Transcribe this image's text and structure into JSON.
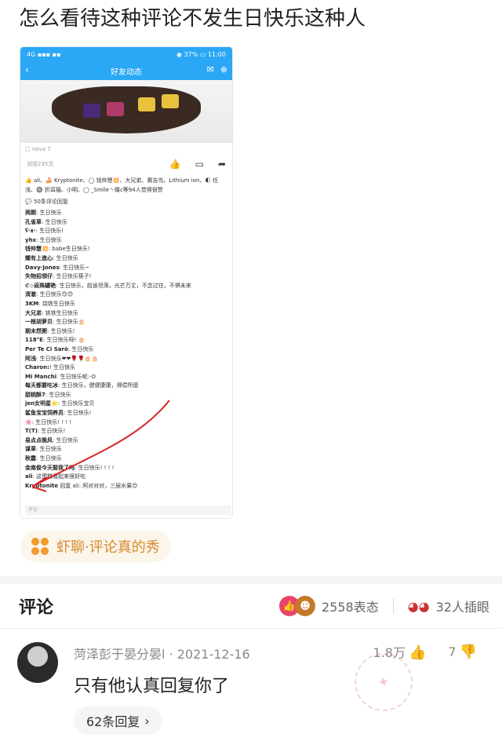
{
  "title": "怎么看待这种评论不发生日快乐这种人",
  "shot": {
    "status_left": "4G ▪▪▪ ▪▪",
    "status_right": "◉ 37% ▭ 11:00",
    "nav_title": "好友动态",
    "device": "▢ nova 7",
    "views": "浏览235次",
    "likes_line": "👍 ali、🍰 Kryptonite、◯ 钱仲慧💥、大兄弟、赛吉鸟、Lithium ion、🌓 任浅、🔘 折耳猫、小明、◯ _Smile丶蝶c等94人觉得很赞",
    "comment_count": "💬 50条评论回复",
    "comments": [
      {
        "name": "两颗",
        "text": ": 生日快乐"
      },
      {
        "name": "孔雀草",
        "text": ": 生日快乐"
      },
      {
        "name": "ʕ·ᴥ·",
        "text": ": 生日快乐!"
      },
      {
        "name": "yhx",
        "text": ": 生日快乐"
      },
      {
        "name": "钱仲慧💥",
        "text": ": babe生日快乐!"
      },
      {
        "name": "耀有上進心",
        "text": ": 生日快乐"
      },
      {
        "name": "Davy·Jones",
        "text": ": 生日快乐~"
      },
      {
        "name": "失物招领仔",
        "text": ": 生日快乐筷子!"
      },
      {
        "name": "ℭ◇返殊罐艳",
        "text": ": 生日快乐，前途坦荡，光芒万丈，不念过往，不惧未来"
      },
      {
        "name": "清澈",
        "text": ": 生日快乐😊😊"
      },
      {
        "name": "3KM",
        "text": ": 烧铁生日快乐"
      },
      {
        "name": "大兄弟",
        "text": ": 铁铁生日快乐"
      },
      {
        "name": "一根胡萝贝",
        "text": ": 生日快乐🎂"
      },
      {
        "name": "期末然粥",
        "text": ": 生日快乐!"
      },
      {
        "name": "118°E",
        "text": ": 生日快乐呀! 🎂"
      },
      {
        "name": "Per Te Ci Sarò",
        "text": ": 生日快乐"
      },
      {
        "name": "阿浅",
        "text": ": 生日快乐❤❤🌹🌹🎂🎂"
      },
      {
        "name": "Charon:",
        "text": "! 生日快乐"
      },
      {
        "name": "Mi Manchi",
        "text": ": 生日快乐呢:-O"
      },
      {
        "name": "每天都要吃冰",
        "text": ": 生日快乐，健健康康，得偿所愿"
      },
      {
        "name": "甜桃酥7",
        "text": ": 生日快乐"
      },
      {
        "name": "jen女明星🌟",
        "text": ": 生日快乐宝贝"
      },
      {
        "name": "鲨鱼宝宝饲养员",
        "text": ": 生日快乐!"
      },
      {
        "name": "🌸",
        "text": ": 生日快乐! ! ! !"
      },
      {
        "name": "T(T)",
        "text": ": 生日快乐!"
      },
      {
        "name": "易点点晚风",
        "text": ": 生日快乐"
      },
      {
        "name": "谋草",
        "text": ": 生日快乐"
      },
      {
        "name": "秋露",
        "text": ": 生日快乐"
      },
      {
        "name": "金南俊今天娶我了吗",
        "text": ": 生日快乐! ! ! !"
      },
      {
        "name": "ali",
        "text": ": 这蛋糕看起来很好吃"
      },
      {
        "name": "Kryptonite",
        "text": " 回复 ali: 阿对对对，三层水果😊"
      }
    ],
    "input_placeholder": "评论"
  },
  "tag": {
    "text": "虾聊·评论真的秀"
  },
  "comments_section": {
    "title": "评论",
    "reaction_count": "2558表态",
    "eye_count": "32人插眼"
  },
  "comment": {
    "author": "菏泽彭于晏分晏l",
    "date": "2021-12-16",
    "likes": "1.8万",
    "dislikes": "7",
    "text": "只有他认真回复你了",
    "replies": "62条回复"
  },
  "colors": {
    "accent_blue": "#2aa7f5",
    "tag_orange": "#f29a2e",
    "arrow_red": "#d7262a"
  }
}
